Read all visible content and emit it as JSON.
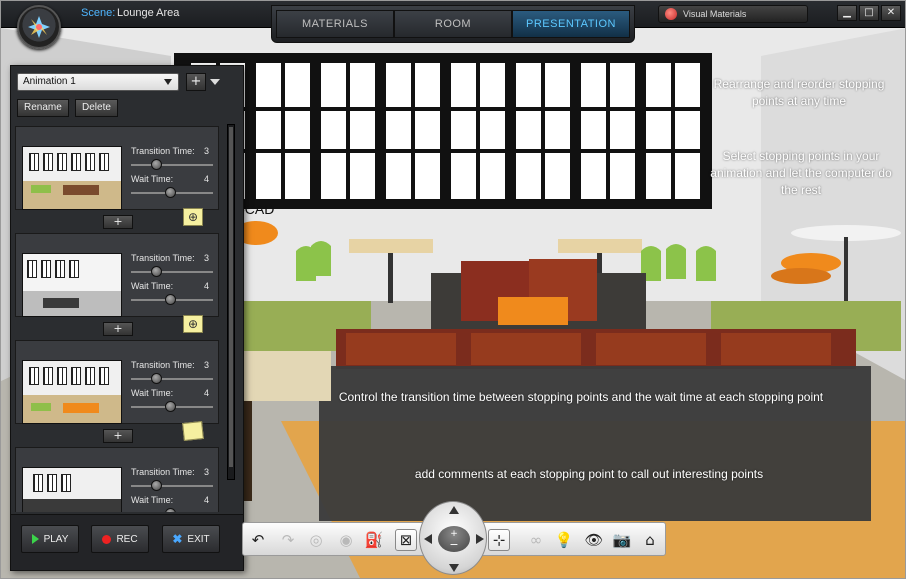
{
  "header": {
    "scene_label": "Scene:",
    "scene_name": "Lounge Area",
    "tabs": [
      {
        "label": "MATERIALS",
        "active": false
      },
      {
        "label": "ROOM",
        "active": false
      },
      {
        "label": "PRESENTATION",
        "active": true
      }
    ],
    "visual_materials": "Visual Materials",
    "window_controls": {
      "minimize": "▁",
      "maximize": "□",
      "close": "✕"
    }
  },
  "panel": {
    "animation_name": "Animation 1",
    "add_symbol": "+",
    "rename": "Rename",
    "delete": "Delete",
    "stops": [
      {
        "transition_label": "Transition Time:",
        "transition_value": "3",
        "wait_label": "Wait Time:",
        "wait_value": "4",
        "has_note": true,
        "note_icon": "⊕",
        "add": "+"
      },
      {
        "transition_label": "Transition Time:",
        "transition_value": "3",
        "wait_label": "Wait Time:",
        "wait_value": "4",
        "has_note": true,
        "note_icon": "⊕",
        "add": "+"
      },
      {
        "transition_label": "Transition Time:",
        "transition_value": "3",
        "wait_label": "Wait Time:",
        "wait_value": "4",
        "has_note": true,
        "note_icon": "",
        "add": "+"
      },
      {
        "transition_label": "Transition Time:",
        "transition_value": "3",
        "wait_label": "Wait Time:",
        "wait_value": "4",
        "has_note": false,
        "note_icon": "",
        "add": ""
      }
    ],
    "play": "PLAY",
    "rec": "REC",
    "exit": "EXIT"
  },
  "annotations": {
    "reorder": "Rearrange and reorder stopping points at any time",
    "select": "Select stopping points in your animation and let the computer do the rest",
    "control": "Control the transition time between stopping points and the wait  time at each stopping point",
    "comments": "add comments at each stopping point to call out interesting points",
    "watermark": "AutoCAD"
  },
  "toolbar_icons": [
    "undo-icon",
    "redo-icon",
    "move-icon",
    "rotate-icon",
    "tag-icon",
    "zoom-extents-icon",
    "fit-icon",
    "link-icon",
    "light-icon",
    "view-icon",
    "camera-icon",
    "home-icon"
  ],
  "colors": {
    "accent": "#5cc8ff",
    "panel": "#2b2d30",
    "note": "#f6f0a0"
  }
}
